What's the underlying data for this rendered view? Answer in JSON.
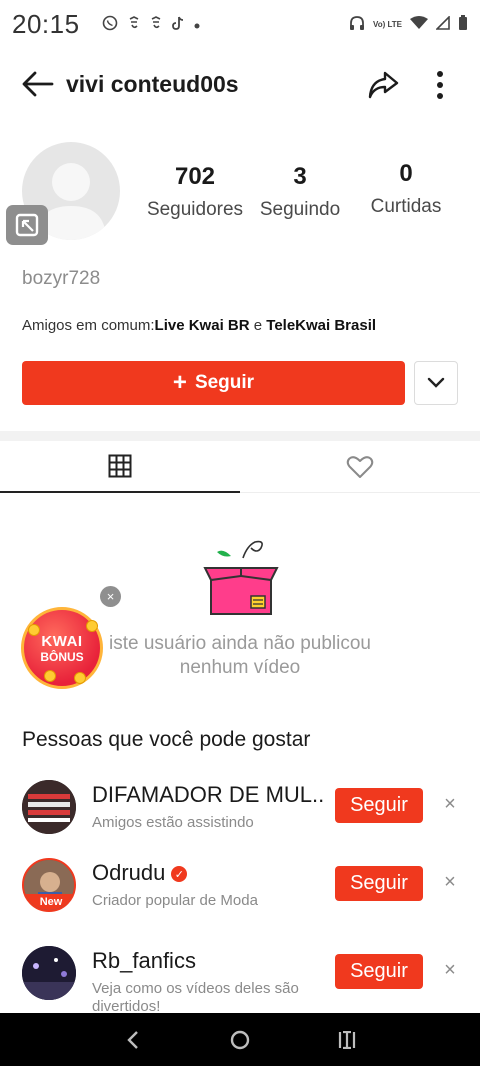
{
  "status_bar": {
    "time": "20:15",
    "notifications": [
      "whatsapp-icon",
      "notif-icon",
      "notif-icon",
      "tiktok-icon",
      "dot-icon"
    ],
    "lte_label": "Vo) LTE"
  },
  "header": {
    "title": "vivi conteud00s"
  },
  "profile": {
    "stats": [
      {
        "value": "702",
        "label": "Seguidores"
      },
      {
        "value": "3",
        "label": "Seguindo"
      },
      {
        "value": "0",
        "label": "Curtidas"
      }
    ],
    "username": "bozyr728",
    "mutual_prefix": "Amigos em comum:",
    "mutual_friend_1": "Live Kwai BR",
    "mutual_joiner": " e ",
    "mutual_friend_2": "TeleKwai Brasil",
    "follow_plus": "+",
    "follow_label": "Seguir"
  },
  "tabs": [
    {
      "icon": "grid-icon",
      "active": true
    },
    {
      "icon": "heart-icon",
      "active": false
    }
  ],
  "empty_state": {
    "text_line1": "iste usuário ainda não publicou",
    "text_line2": "nenhum vídeo"
  },
  "bonus": {
    "line1": "KWAI",
    "line2": "BÔNUS",
    "close": "×"
  },
  "suggestions": {
    "title": "Pessoas que você pode gostar",
    "items": [
      {
        "name": "DIFAMADOR DE MUL...",
        "subtitle": "Amigos estão assistindo",
        "button": "Seguir",
        "badge": "",
        "verified": false
      },
      {
        "name": "Odrudu",
        "subtitle": "Criador popular de Moda",
        "button": "Seguir",
        "badge": "New",
        "verified": true
      },
      {
        "name": "Rb_fanfics",
        "subtitle": "Veja como os vídeos deles são divertidos!",
        "button": "Seguir",
        "badge": "",
        "verified": false
      }
    ],
    "close": "×"
  },
  "colors": {
    "accent": "#f0391e",
    "text_muted": "#8c8c8c"
  }
}
